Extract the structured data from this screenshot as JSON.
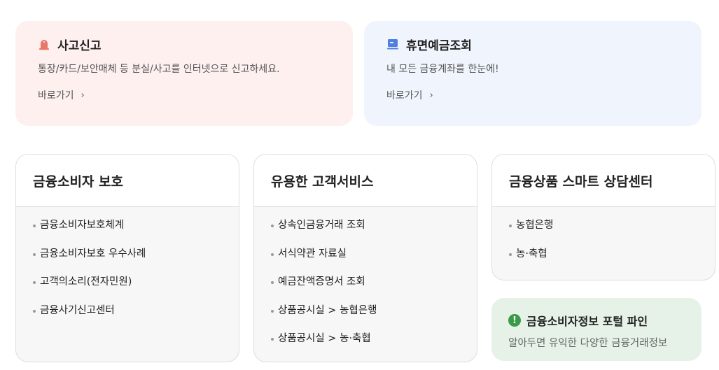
{
  "banners": {
    "accident": {
      "title": "사고신고",
      "description": "통장/카드/보안매체 등 분실/사고를 인터넷으로 신고하세요.",
      "link": "바로가기",
      "icon": "alert-bell-icon",
      "bg_color": "#fdf0ef",
      "icon_color": "#e8766a"
    },
    "dormant": {
      "title": "휴면예금조회",
      "description": "내 모든 금융계좌를 한눈에!",
      "link": "바로가기",
      "icon": "monitor-icon",
      "bg_color": "#f0f5fd",
      "icon_color": "#4f7fe0"
    }
  },
  "cards": {
    "protection": {
      "title": "금융소비자 보호",
      "items": [
        "금융소비자보호체계",
        "금융소비자보호 우수사례",
        "고객의소리(전자민원)",
        "금융사기신고센터"
      ]
    },
    "services": {
      "title": "유용한 고객서비스",
      "items": [
        "상속인금융거래 조회",
        "서식약관 자료실",
        "예금잔액증명서 조회",
        "상품공시실 > 농협은행",
        "상품공시실 > 농·축협"
      ]
    },
    "consult": {
      "title": "금융상품 스마트 상담센터",
      "items": [
        "농협은행",
        "농·축협"
      ]
    }
  },
  "pine": {
    "title": "금융소비자정보 포털 파인",
    "description": "알아두면 유익한 다양한 금융거래정보",
    "icon": "exclamation-circle-icon",
    "icon_color": "#3a9a4a",
    "bg_color": "#e6f2e8"
  }
}
